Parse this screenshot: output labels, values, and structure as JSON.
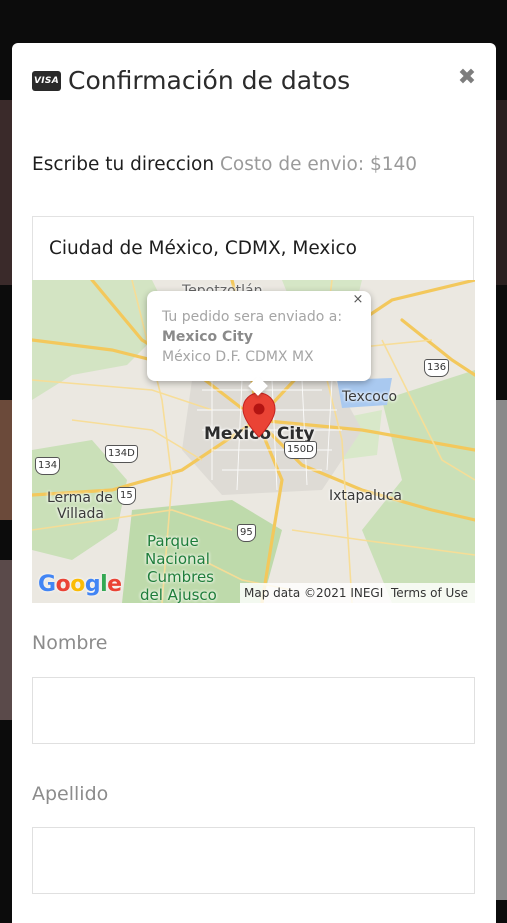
{
  "modal": {
    "title": "Confirmación de datos",
    "card_brand": "VISA",
    "close_glyph": "✖"
  },
  "address": {
    "label": "Escribe tu direccion",
    "shipping_cost": "Costo de envio: $140",
    "value": "Ciudad de México, CDMX, Mexico"
  },
  "map": {
    "info_window": {
      "line1": "Tu pedido sera enviado a:",
      "line2": "Mexico City",
      "line3": "México D.F. CDMX MX",
      "close_glyph": "×"
    },
    "labels": {
      "top_town": "Tepotzotlán",
      "city": "Mexico City",
      "texcoco": "Texcoco",
      "ixtapaluca": "Ixtapaluca",
      "lerma_1": "Lerma de",
      "lerma_2": "Villada",
      "park_1": "Parque",
      "park_2": "Nacional",
      "park_3": "Cumbres",
      "park_4": "del Ajusco"
    },
    "shields": [
      "134",
      "134D",
      "15",
      "150D",
      "136",
      "95"
    ],
    "logo": "Google",
    "map_data": "Map data ©2021 INEGI",
    "terms": "Terms of Use",
    "colors": {
      "pin": "#ea4335",
      "roads": "#f8d57e",
      "water": "#9fc3f0",
      "parks": "#c3dfb0"
    }
  },
  "form": {
    "nombre_label": "Nombre",
    "apellido_label": "Apellido",
    "nombre_value": "",
    "apellido_value": ""
  }
}
